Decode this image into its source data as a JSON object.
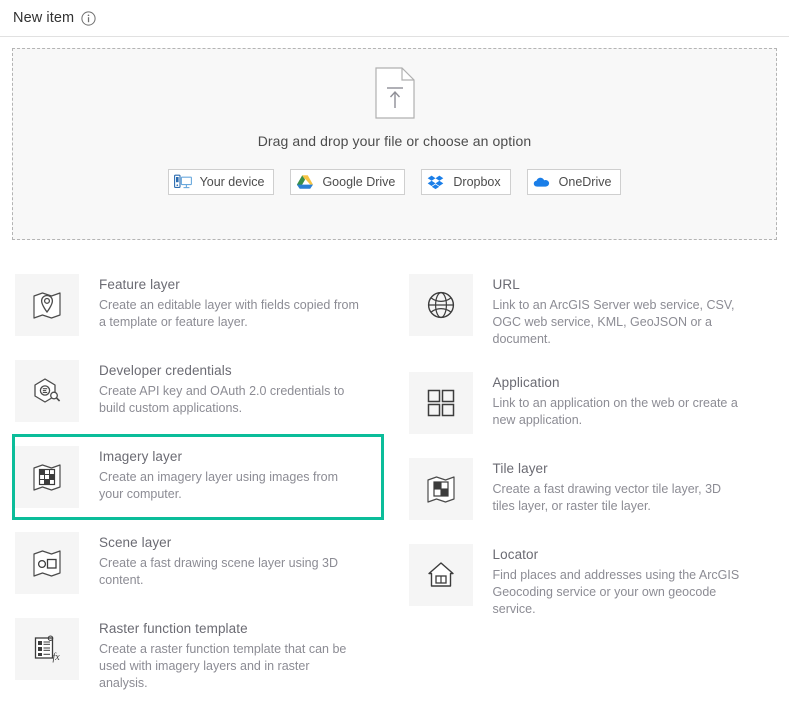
{
  "header": {
    "title": "New item",
    "info_icon": "info-circle-icon"
  },
  "dropzone": {
    "upload_icon": "file-upload-icon",
    "prompt": "Drag and drop your file or choose an option",
    "sources": [
      {
        "label": "Your device",
        "icon": "device-computer-icon"
      },
      {
        "label": "Google Drive",
        "icon": "google-drive-icon"
      },
      {
        "label": "Dropbox",
        "icon": "dropbox-icon"
      },
      {
        "label": "OneDrive",
        "icon": "onedrive-cloud-icon"
      }
    ]
  },
  "selection": {
    "selected_item": "Imagery layer",
    "highlight_color": "#0bbd9a"
  },
  "items": {
    "left": [
      {
        "title": "Feature layer",
        "description": "Create an editable layer with fields copied from a template or feature layer.",
        "icon": "feature-layer-icon",
        "selected": false
      },
      {
        "title": "Developer credentials",
        "description": "Create API key and OAuth 2.0 credentials to build custom applications.",
        "icon": "developer-credentials-icon",
        "selected": false
      },
      {
        "title": "Imagery layer",
        "description": "Create an imagery layer using images from your computer.",
        "icon": "imagery-layer-icon",
        "selected": true
      },
      {
        "title": "Scene layer",
        "description": "Create a fast drawing scene layer using 3D content.",
        "icon": "scene-layer-icon",
        "selected": false
      },
      {
        "title": "Raster function template",
        "description": "Create a raster function template that can be used with imagery layers and in raster analysis.",
        "icon": "raster-function-template-icon",
        "selected": false
      }
    ],
    "right": [
      {
        "title": "URL",
        "description": "Link to an ArcGIS Server web service, CSV, OGC web service, KML, GeoJSON or a document.",
        "icon": "globe-icon",
        "selected": false
      },
      {
        "title": "Application",
        "description": "Link to an application on the web or create a new application.",
        "icon": "application-grid-icon",
        "selected": false
      },
      {
        "title": "Tile layer",
        "description": "Create a fast drawing vector tile layer, 3D tiles layer, or raster tile layer.",
        "icon": "tile-layer-icon",
        "selected": false
      },
      {
        "title": "Locator",
        "description": "Find places and addresses using the ArcGIS Geocoding service or your own geocode service.",
        "icon": "locator-house-icon",
        "selected": false
      }
    ]
  },
  "colors": {
    "text_primary": "#323232",
    "text_secondary": "#6b6b73",
    "text_muted": "#8c8c94",
    "accent_teal": "#0bbd9a",
    "icon_box_bg": "#f5f5f5",
    "dropzone_bg": "#f8f8f8",
    "border": "#e1e1e1"
  }
}
